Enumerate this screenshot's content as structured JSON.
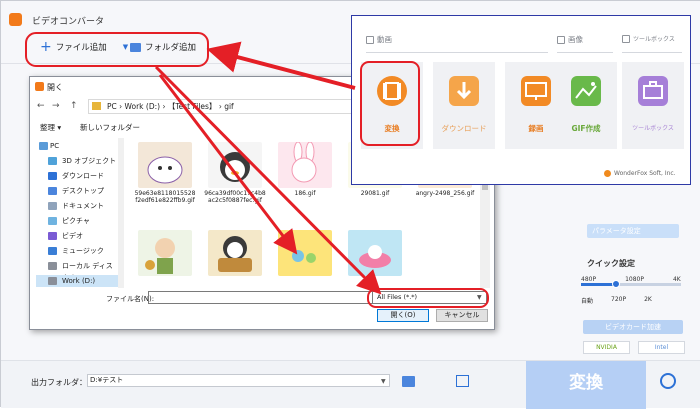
{
  "app": {
    "title": "ビデオコンバータ"
  },
  "toolbar": {
    "add_file": "ファイル追加",
    "add_folder": "フォルダ追加"
  },
  "dialog": {
    "title": "開く",
    "breadcrumb": "PC  ›  Work (D:)  ›  【Test Files】  ›  gif",
    "organize": "整理 ▾",
    "new_folder": "新しいフォルダー",
    "nav_items": [
      {
        "label": "PC",
        "icon": "pc-icon",
        "color": "#5a9bd8"
      },
      {
        "label": "3D オブジェクト",
        "icon": "3d-objects-icon",
        "color": "#4fa2d9"
      },
      {
        "label": "ダウンロード",
        "icon": "download-icon",
        "color": "#2d71d6"
      },
      {
        "label": "デスクトップ",
        "icon": "desktop-icon",
        "color": "#4b85dd"
      },
      {
        "label": "ドキュメント",
        "icon": "documents-icon",
        "color": "#8fa3bb"
      },
      {
        "label": "ピクチャ",
        "icon": "pictures-icon",
        "color": "#6fb3e0"
      },
      {
        "label": "ビデオ",
        "icon": "videos-icon",
        "color": "#7a5bd4"
      },
      {
        "label": "ミュージック",
        "icon": "music-icon",
        "color": "#3a7ed6"
      },
      {
        "label": "ローカル ディスク (C",
        "icon": "local-disk-icon",
        "color": "#8a8f99"
      },
      {
        "label": "Work (D:)",
        "icon": "drive-icon",
        "color": "#8a8f99"
      }
    ],
    "files": [
      {
        "name": "59e63e8118015528f2edf61e822ffb9.gif",
        "color": "#f3e7d8",
        "accent": "#8a5fa8"
      },
      {
        "name": "96ca39df00c17c4b8ac2c5f0887fec.gif",
        "color": "#f5f5f5",
        "accent": "#3a3a3a"
      },
      {
        "name": "186.gif",
        "color": "#fde7ee",
        "accent": "#f39ab3"
      },
      {
        "name": "29081.gif",
        "color": "#fbfbea",
        "accent": "#c9d26e"
      },
      {
        "name": "angry-2498_256.gif",
        "color": "#fbe9d6",
        "accent": "#e8a15a"
      },
      {
        "name": "",
        "color": "#eef4e6",
        "accent": "#7fa34c"
      },
      {
        "name": "",
        "color": "#f4e8c9",
        "accent": "#c08a3c"
      },
      {
        "name": "",
        "color": "#fde47a",
        "accent": "#f0c500"
      },
      {
        "name": "",
        "color": "#bfe6f4",
        "accent": "#f27fa8"
      }
    ],
    "filename_label": "ファイル名(N):",
    "file_type": "All Files (*.*)",
    "open_button": "開く(O)",
    "cancel_button": "キャンセル"
  },
  "popup": {
    "sections": {
      "video": "動画",
      "image": "画像",
      "toolbox": "ツールボックス"
    },
    "tiles": [
      {
        "label": "変換",
        "icon": "film-icon",
        "color": "#f28a25"
      },
      {
        "label": "ダウンロード",
        "icon": "download-arrow-icon",
        "color": "#f5a54a"
      },
      {
        "label": "録画",
        "icon": "monitor-icon",
        "color": "#f28a25"
      },
      {
        "label": "GIF作成",
        "icon": "image-icon",
        "color": "#69b94a"
      },
      {
        "label": "ツールボックス",
        "icon": "toolbox-icon",
        "color": "#a67fd8"
      }
    ],
    "brand": "WonderFox Soft, Inc."
  },
  "right_panel": {
    "param_settings": "パラメータ設定",
    "quick_settings": "クイック設定",
    "quality_top": [
      "480P",
      "1080P",
      "4K"
    ],
    "quality_bottom": [
      "自動",
      "720P",
      "2K"
    ],
    "gpu": "ビデオカード加速",
    "nvidia": "NVIDIA",
    "intel": "Intel"
  },
  "bottom": {
    "output_label": "出力フォルダ：",
    "output_path": "D:¥テスト",
    "convert": "変換"
  },
  "colors": {
    "accent": "#2d71d6",
    "highlight": "#e41f26",
    "orange": "#f28a25"
  }
}
